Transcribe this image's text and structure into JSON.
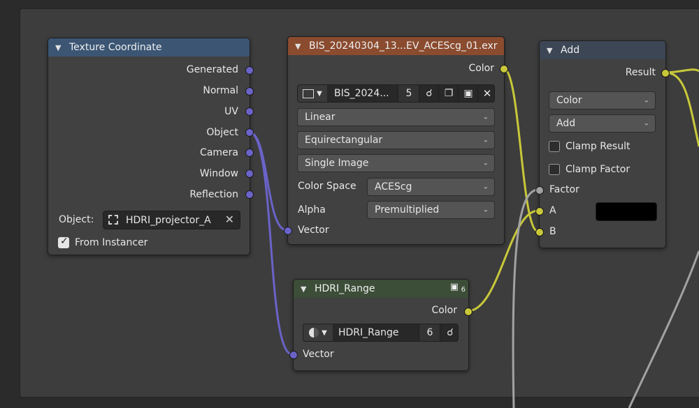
{
  "colors": {
    "vector_socket": "#6a63c8",
    "color_socket": "#c8c83a",
    "float_socket": "#a2a2a2",
    "header_texcoord": "#3b5573",
    "header_image": "#8a4b2f",
    "header_group": "#3c4d38",
    "header_math": "#3c4655"
  },
  "tex_coord": {
    "title": "Texture Coordinate",
    "outputs": [
      "Generated",
      "Normal",
      "UV",
      "Object",
      "Camera",
      "Window",
      "Reflection"
    ],
    "object_label": "Object:",
    "object_value": "HDRI_projector_A",
    "from_instancer": "From Instancer"
  },
  "image_tex": {
    "title": "BIS_20240304_13...EV_ACEScg_01.exr",
    "output": "Color",
    "image_name": "BIS_2024...",
    "users": "5",
    "interpolation": "Linear",
    "projection": "Equirectangular",
    "extension": "Single Image",
    "color_space_label": "Color Space",
    "color_space_value": "ACEScg",
    "alpha_label": "Alpha",
    "alpha_value": "Premultiplied",
    "input": "Vector"
  },
  "group": {
    "title": "HDRI_Range",
    "badge": "6",
    "output": "Color",
    "group_name": "HDRI_Range",
    "users": "6",
    "input": "Vector"
  },
  "mix": {
    "title": "Add",
    "output": "Result",
    "data_type": "Color",
    "blend_type": "Add",
    "clamp_result": "Clamp Result",
    "clamp_factor": "Clamp Factor",
    "inputs": [
      "Factor",
      "A",
      "B"
    ]
  }
}
